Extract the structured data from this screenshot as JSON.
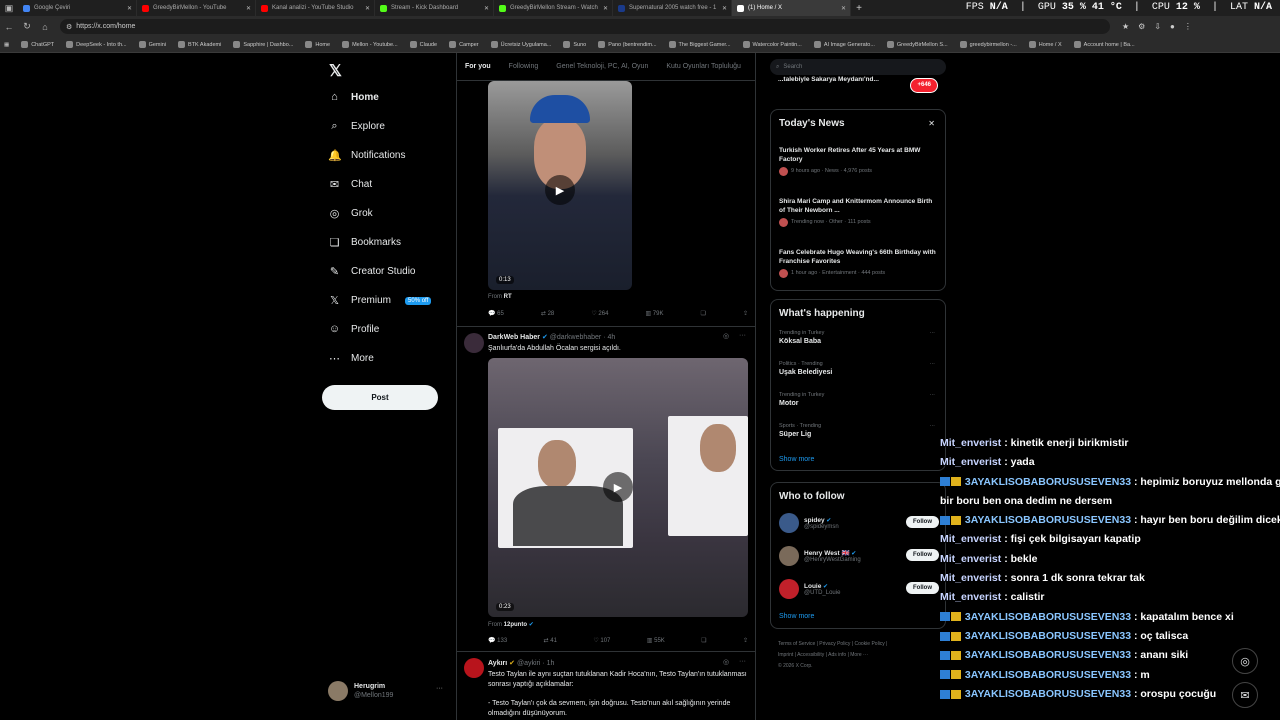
{
  "browser": {
    "tabs": [
      {
        "title": "Google Çeviri",
        "color": "#4285f4"
      },
      {
        "title": "GreedyBirMellon - YouTube",
        "color": "#ff0000"
      },
      {
        "title": "Kanal analizi - YouTube Studio",
        "color": "#ff0000"
      },
      {
        "title": "Stream - Kick Dashboard",
        "color": "#53fc18"
      },
      {
        "title": "GreedyBirMellon Stream - Watch",
        "color": "#53fc18"
      },
      {
        "title": "Supernatural 2005 watch free - 1",
        "color": "#1a3a8a"
      },
      {
        "title": "(1) Home / X",
        "color": "#ffffff",
        "active": true
      }
    ],
    "new_tab": "+",
    "url": "https://x.com/home",
    "overlay": {
      "fps_label": "FPS",
      "fps": "N/A",
      "gpu_label": "GPU",
      "gpu": "35 %  41 °C",
      "cpu_label": "CPU",
      "cpu": "12 %",
      "lat_label": "LAT",
      "lat": "N/A"
    },
    "bookmarks": [
      "ChatGPT",
      "DeepSeek - Into th...",
      "Gemini",
      "BTK Akademi",
      "Sapphire | Dashbo...",
      "Home",
      "Mellon - Youtube...",
      "Claude",
      "Camper",
      "Ücretsiz Uygulama...",
      "Suno",
      "Pano (bentrendim...",
      "The Biggest Gamer...",
      "Watercolor Paintin...",
      "AI Image Generato...",
      "GreedyBirMellon S...",
      "greedybirmellon -...",
      "Home / X",
      "Account home | Ba..."
    ]
  },
  "leftnav": {
    "logo": "𝕏",
    "items": [
      {
        "label": "Home",
        "icon": "⌂"
      },
      {
        "label": "Explore",
        "icon": "⌕"
      },
      {
        "label": "Notifications",
        "icon": "🔔"
      },
      {
        "label": "Chat",
        "icon": "✉"
      },
      {
        "label": "Grok",
        "icon": "◎"
      },
      {
        "label": "Bookmarks",
        "icon": "❏"
      },
      {
        "label": "Creator Studio",
        "icon": "✎"
      },
      {
        "label": "Premium",
        "icon": "𝕏",
        "badge": "50% off"
      },
      {
        "label": "Profile",
        "icon": "☺"
      },
      {
        "label": "More",
        "icon": "⋯"
      }
    ],
    "post_button": "Post",
    "account": {
      "name": "Herugrim",
      "handle": "@Mellon199"
    }
  },
  "feed": {
    "tabs": [
      "For you",
      "Following",
      "Genel Teknoloji, PC, AI, Oyun",
      "Kutu Oyunları Topluluğu"
    ],
    "post1": {
      "duration": "0:13",
      "from_label": "From",
      "from": "RT",
      "replies": "65",
      "reposts": "28",
      "likes": "264",
      "views": "79K"
    },
    "post2": {
      "name": "DarkWeb Haber",
      "handle": "@darkwebhaber · 4h",
      "text": "Şanlıurfa'da Abdullah Öcalan sergisi açıldı.",
      "duration": "0:23",
      "from_label": "From",
      "from": "12punto",
      "replies": "133",
      "reposts": "41",
      "likes": "107",
      "views": "55K"
    },
    "post3": {
      "name": "Aykırı",
      "handle": "@aykiri · 1h",
      "text1": "Testo Taylan ile aynı suçtan tutuklanan Kadir Hoca'nın, Testo Taylan'ın tutuklanması sonrası yaptığı açıklamalar:",
      "text2": "- Testo Taylan'ı çok da sevmem, işin doğrusu. Testo'nun akıl sağlığının yerinde olmadığını düşünüyorum."
    }
  },
  "right": {
    "search_placeholder": "Search",
    "promo": {
      "text": "...talebiyle Sakarya Meydanı'nd...",
      "count": "+646"
    },
    "todays_news": {
      "title": "Today's News",
      "close": "✕",
      "items": [
        {
          "headline": "Turkish Worker Retires After 45 Years at BMW Factory",
          "meta": "9 hours ago · News · 4,976 posts"
        },
        {
          "headline": "Shira Mari Camp and Knittermom Announce Birth of Their Newborn ...",
          "meta": "Trending now · Other · 111 posts"
        },
        {
          "headline": "Fans Celebrate Hugo Weaving's 66th Birthday with Franchise Favorites",
          "meta": "1 hour ago · Entertainment · 444 posts"
        }
      ]
    },
    "whats_happening": {
      "title": "What's happening",
      "items": [
        {
          "context": "Trending in Turkey",
          "name": "Köksal Baba"
        },
        {
          "context": "Politics · Trending",
          "name": "Uşak Belediyesi"
        },
        {
          "context": "Trending in Turkey",
          "name": "Motor"
        },
        {
          "context": "Sports · Trending",
          "name": "Süper Lig"
        }
      ],
      "show_more": "Show more"
    },
    "who_to_follow": {
      "title": "Who to follow",
      "users": [
        {
          "name": "spidey",
          "handle": "@spideymsn",
          "color": "#3a5a8a"
        },
        {
          "name": "Henry West 🇬🇧",
          "handle": "@HenryWestGaming",
          "color": "#7a6a5a"
        },
        {
          "name": "Louie",
          "handle": "@UTD_Louie",
          "color": "#c0202a"
        }
      ],
      "follow": "Follow",
      "show_more": "Show more"
    },
    "footer": {
      "line1": "Terms of Service  |  Privacy Policy  |  Cookie Policy  |",
      "line2": "Imprint  |  Accessibility  |  Ads info  |  More ···",
      "line3": "© 2026 X Corp."
    }
  },
  "chat": [
    {
      "user": "Mit_enverist",
      "msg": ": kinetik enerji birikmistir",
      "badges": false
    },
    {
      "user": "Mit_enverist",
      "msg": ": yada",
      "badges": false
    },
    {
      "user": "3AYAKLISOBABORUSUSEVEN33",
      "msg": ": hepimiz boruyuz mellonda giz",
      "badges": true,
      "cont": "bir boru ben ona dedim ne dersem"
    },
    {
      "user": "3AYAKLISOBABORUSUSEVEN33",
      "msg": ": hayır ben boru değilim dicek",
      "badges": true
    },
    {
      "user": "Mit_enverist",
      "msg": ": fişi çek bilgisayarı kapatip",
      "badges": false
    },
    {
      "user": "Mit_enverist",
      "msg": ": bekle",
      "badges": false
    },
    {
      "user": "Mit_enverist",
      "msg": ": sonra 1 dk sonra tekrar tak",
      "badges": false
    },
    {
      "user": "Mit_enverist",
      "msg": ": calistir",
      "badges": false
    },
    {
      "user": "3AYAKLISOBABORUSUSEVEN33",
      "msg": ": kapatalım bence xi",
      "badges": true
    },
    {
      "user": "3AYAKLISOBABORUSUSEVEN33",
      "msg": ": oç talisca",
      "badges": true
    },
    {
      "user": "3AYAKLISOBABORUSUSEVEN33",
      "msg": ": ananı siki",
      "badges": true
    },
    {
      "user": "3AYAKLISOBABORUSUSEVEN33",
      "msg": ": m",
      "badges": true
    },
    {
      "user": "3AYAKLISOBABORUSUSEVEN33",
      "msg": ": orospu çocuğu",
      "badges": true
    }
  ]
}
